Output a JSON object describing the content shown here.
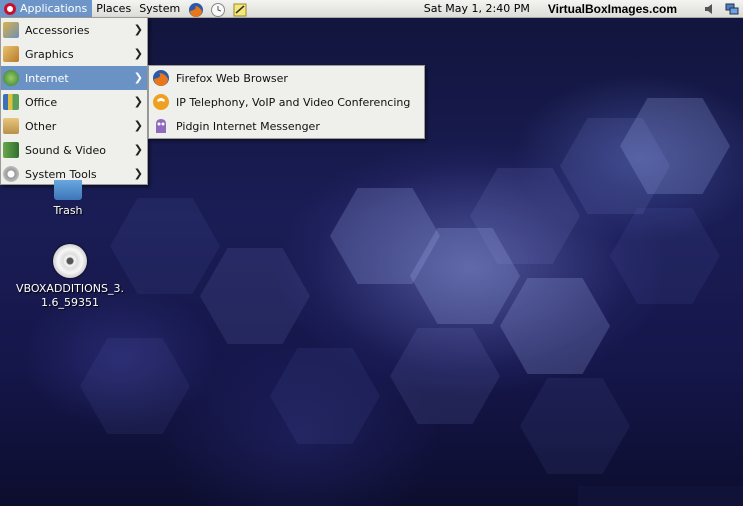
{
  "panel": {
    "menus": [
      "Applications",
      "Places",
      "System"
    ],
    "clock": "Sat May  1,  2:40 PM",
    "site": "VirtualBoxImages.com"
  },
  "apps_menu": {
    "items": [
      {
        "label": "Accessories"
      },
      {
        "label": "Graphics"
      },
      {
        "label": "Internet"
      },
      {
        "label": "Office"
      },
      {
        "label": "Other"
      },
      {
        "label": "Sound & Video"
      },
      {
        "label": "System Tools"
      }
    ],
    "active_index": 2
  },
  "internet_submenu": {
    "items": [
      {
        "label": "Firefox Web Browser",
        "icon": "firefox-icon"
      },
      {
        "label": "IP Telephony, VoIP and Video Conferencing",
        "icon": "ekiga-icon"
      },
      {
        "label": "Pidgin Internet Messenger",
        "icon": "pidgin-icon"
      }
    ]
  },
  "desktop": {
    "trash_label": "Trash",
    "vbox_label": "VBOXADDITIONS_3.1.6_59351",
    "vbox_label_line1": "VBOXADDITIONS_3.",
    "vbox_label_line2": "1.6_59351"
  },
  "colors": {
    "highlight": "#6b92c4",
    "panel": "#e8e8e4",
    "menu_bg": "#efefec"
  }
}
